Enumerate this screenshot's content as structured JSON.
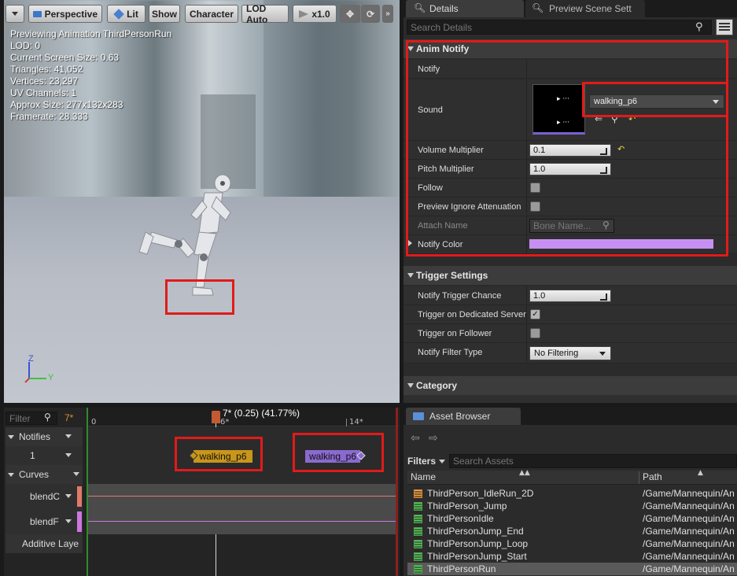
{
  "viewport": {
    "toolbar": {
      "perspective": "Perspective",
      "lit": "Lit",
      "show": "Show",
      "character": "Character",
      "lod": "LOD Auto",
      "speed": "x1.0"
    },
    "stats": [
      "Previewing Animation ThirdPersonRun",
      "LOD: 0",
      "Current Screen Size: 0.63",
      "Triangles: 41,052",
      "Vertices: 23,297",
      "UV Channels: 1",
      "Approx Size: 277x132x283",
      "Framerate: 28.333"
    ],
    "axis": {
      "z": "Z",
      "y": "Y"
    }
  },
  "details": {
    "tabs": [
      "Details",
      "Preview Scene Sett"
    ],
    "search_placeholder": "Search Details",
    "anim_notify": {
      "title": "Anim Notify",
      "notify_label": "Notify",
      "sound_label": "Sound",
      "sound_value": "walking_p6",
      "volume_label": "Volume Multiplier",
      "volume_value": "0.1",
      "pitch_label": "Pitch Multiplier",
      "pitch_value": "1.0",
      "follow_label": "Follow",
      "preview_ignore_label": "Preview Ignore Attenuation",
      "attach_label": "Attach Name",
      "attach_placeholder": "Bone Name...",
      "color_label": "Notify Color",
      "color_value": "#c88ff2"
    },
    "trigger_settings": {
      "title": "Trigger Settings",
      "chance_label": "Notify Trigger Chance",
      "chance_value": "1.0",
      "dedicated_label": "Trigger on Dedicated Server",
      "dedicated_checked": true,
      "follower_label": "Trigger on Follower",
      "filter_label": "Notify Filter Type",
      "filter_value": "No Filtering"
    },
    "category": {
      "title": "Category"
    }
  },
  "timeline": {
    "filter_placeholder": "Filter",
    "frame_badge": "7*",
    "ticks": [
      "0",
      "6*",
      "14*"
    ],
    "scrub_readout": "7* (0.25) (41.77%)",
    "tracks": {
      "notifies": "Notifies",
      "notify_index": "1",
      "curves": "Curves",
      "curve1": "blendC",
      "curve2": "blendF",
      "additive": "Additive Laye"
    },
    "notify1": "walking_p6",
    "notify2": "walking_p6"
  },
  "asset_browser": {
    "tab": "Asset Browser",
    "filters": "Filters",
    "search_placeholder": "Search Assets",
    "col_name": "Name",
    "col_path": "Path",
    "rows": [
      {
        "name": "ThirdPerson_IdleRun_2D",
        "path": "/Game/Mannequin/An"
      },
      {
        "name": "ThirdPerson_Jump",
        "path": "/Game/Mannequin/An"
      },
      {
        "name": "ThirdPersonIdle",
        "path": "/Game/Mannequin/An"
      },
      {
        "name": "ThirdPersonJump_End",
        "path": "/Game/Mannequin/An"
      },
      {
        "name": "ThirdPersonJump_Loop",
        "path": "/Game/Mannequin/An"
      },
      {
        "name": "ThirdPersonJump_Start",
        "path": "/Game/Mannequin/An"
      },
      {
        "name": "ThirdPersonRun",
        "path": "/Game/Mannequin/An"
      }
    ]
  }
}
